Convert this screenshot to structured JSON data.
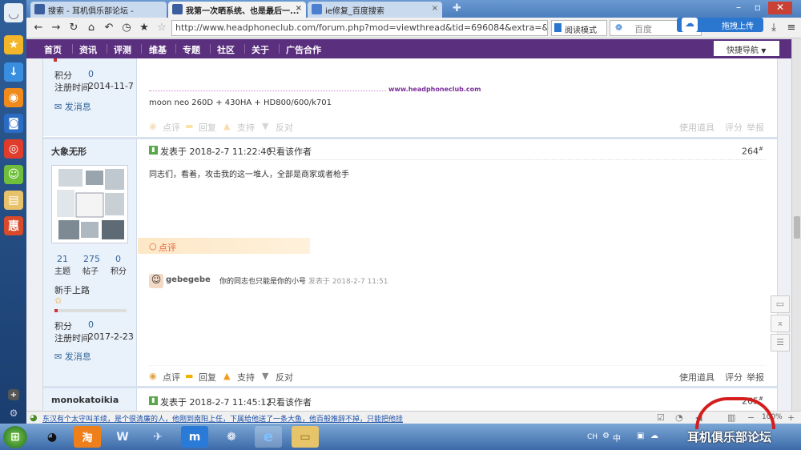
{
  "browser": {
    "tabs": [
      {
        "label": "搜索 - 耳机俱乐部论坛 -"
      },
      {
        "label": "我第一次晒系统、也是最后一..."
      },
      {
        "label": "ie修复_百度搜索"
      }
    ],
    "url": "http://www.headphoneclub.com/forum.php?mod=viewthread&tid=696084&extra=&highlight=",
    "reader_label": "阅读模式",
    "search_placeholder": "百度",
    "upload_label": "拖拽上传"
  },
  "site_nav": {
    "items": [
      "首页",
      "资讯",
      "评测",
      "维基",
      "专题",
      "社区",
      "关于",
      "广告合作"
    ],
    "quick_nav": "快捷导航"
  },
  "post_prev": {
    "points_label": "积分",
    "points": "0",
    "reg_label": "注册时间",
    "reg": "2014-11-7",
    "msg": "发消息",
    "sig_link": "www.headphoneclub.com",
    "signature": "moon neo 260D + 430HA + HD800/600/k701",
    "actions": {
      "rate": "点评",
      "reply": "回复",
      "support": "支持",
      "oppose": "反对",
      "tools": "使用道具",
      "score": "评分",
      "report": "举报"
    }
  },
  "post_264": {
    "author": "大象无形",
    "threads": "21",
    "posts": "275",
    "points": "0",
    "threads_label": "主题",
    "posts_label": "帖子",
    "points_label": "积分",
    "rank": "新手上路",
    "points_label2": "积分",
    "points2": "0",
    "reg_label": "注册时间",
    "reg": "2017-2-23",
    "msg": "发消息",
    "posted": "发表于 2018-2-7 11:22:40",
    "only_author": "只看该作者",
    "floor": "264",
    "floor_mark": "#",
    "body": "同志们，看着，攻击我的这一堆人，全部是商家或者枪手",
    "comment_header": "点评",
    "comment": {
      "user": "gebegebe",
      "text": "你的同志也只能是你的小号",
      "time": "发表于 2018-2-7 11:51"
    },
    "actions": {
      "rate": "点评",
      "reply": "回复",
      "support": "支持",
      "oppose": "反对",
      "tools": "使用道具",
      "score": "评分",
      "report": "举报"
    }
  },
  "post_next": {
    "author": "monokatoikia",
    "posted": "发表于 2018-2-7 11:45:12",
    "only_author": "只看该作者",
    "floor": "265",
    "floor_mark": "#"
  },
  "status": {
    "ticker": "东汉有个太守叫羊续，是个很清廉的人，他刚到南阳上任，下属给他送了一条大鱼，他百般推辞不掉，只能把他挂",
    "zoom": "100%"
  },
  "taskbar": {
    "lang": "CH",
    "ime": "中"
  },
  "watermark": "耳机俱乐部论坛"
}
